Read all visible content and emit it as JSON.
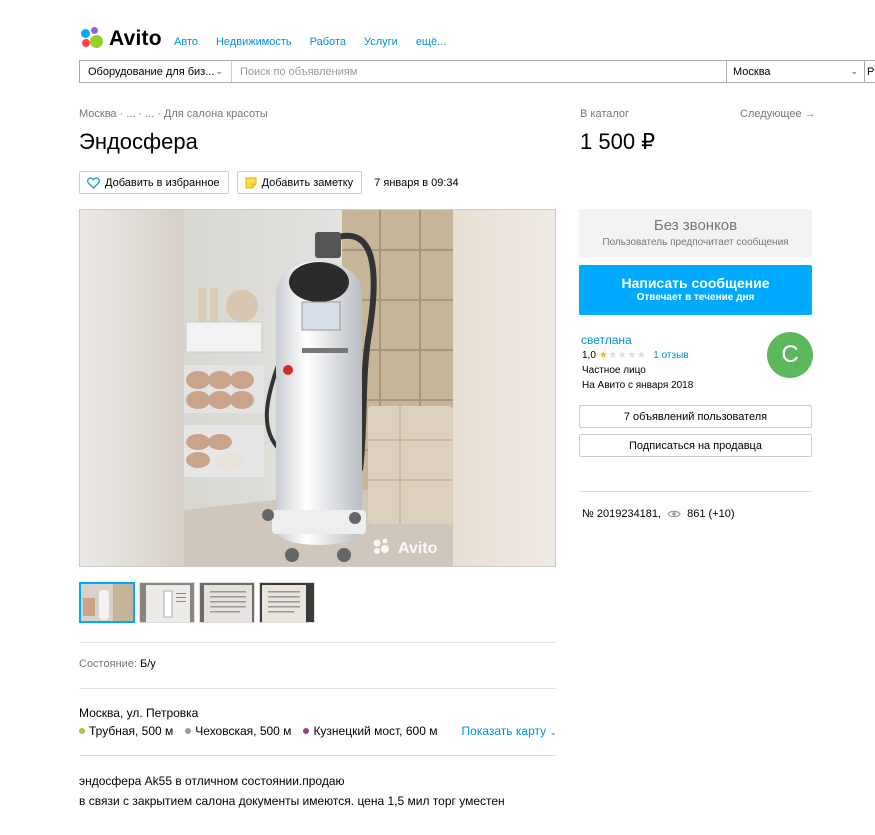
{
  "header": {
    "logo_text": "Avito",
    "nav": [
      "Авто",
      "Недвижимость",
      "Работа",
      "Услуги",
      "ещё..."
    ]
  },
  "search": {
    "category": "Оборудование для биз...",
    "placeholder": "Поиск по объявлениям",
    "city": "Москва",
    "extra": "Р"
  },
  "breadcrumb": [
    "Москва",
    "·",
    "...",
    "·",
    "...",
    "·",
    "Для салона красоты"
  ],
  "title": "Эндосфера",
  "actions": {
    "favorite": "Добавить в избранное",
    "note": "Добавить заметку",
    "date": "7 января в 09:34"
  },
  "photo": {
    "watermark": "Avito",
    "thumbs_count": 4
  },
  "condition": {
    "label": "Состояние:",
    "value": "Б/у"
  },
  "address": "Москва, ул. Петровка",
  "metro": [
    {
      "name": "Трубная, 500 м",
      "color": "#a2c83b"
    },
    {
      "name": "Чеховская, 500 м",
      "color": "#9a9a9a"
    },
    {
      "name": "Кузнецкий мост, 600 м",
      "color": "#943e90"
    }
  ],
  "show_map": "Показать карту",
  "description": [
    "эндосфера Ak55 в отличном состоянии.продаю",
    "в связи с закрытием салона документы имеются. цена 1,5 мил торг уместен"
  ],
  "sidebar": {
    "catalog": "В каталог",
    "next": "Следующее →",
    "price": "1 500 ₽",
    "no_calls_title": "Без звонков",
    "no_calls_sub": "Пользователь предпочитает сообщения",
    "message_btn": "Написать сообщение",
    "message_sub": "Отвечает в течение дня",
    "seller": {
      "name": "светлана",
      "rating": "1,0",
      "rating_value": 1,
      "rating_max": 5,
      "reviews": "1 отзыв",
      "type": "Частное лицо",
      "since": "На Авито с января 2018",
      "avatar_letter": "С"
    },
    "user_ads": "7 объявлений пользователя",
    "subscribe": "Подписаться на продавца",
    "item_no": "№ 2019234181,",
    "views": "861 (+10)"
  },
  "colors": {
    "accent": "#00aaff",
    "link": "#0091d9",
    "avatar": "#5cb85c",
    "star": "#ffb021"
  }
}
